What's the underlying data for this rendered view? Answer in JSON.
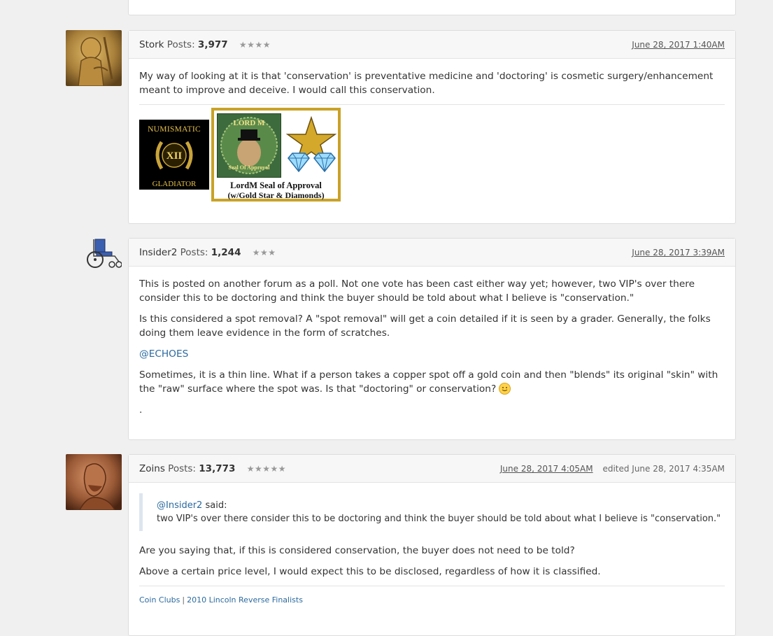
{
  "posts": [
    {
      "username": "Stork",
      "posts_label": "Posts:",
      "post_count": "3,977",
      "rank_stars": "★★★★",
      "date": "June 28, 2017 1:40AM",
      "paragraphs": [
        "My way of looking at it is that 'conservation' is preventative medicine and 'doctoring' is cosmetic surgery/enhancement meant to improve and deceive. I would call this conservation."
      ],
      "badges": {
        "gladiator": {
          "line1": "NUMISMATIC",
          "numeral": "XII",
          "line2": "GLADIATOR"
        },
        "seal": {
          "top_label": "LORD M",
          "seal_text": "Seal Of Approval",
          "caption1": "LordM Seal of Approval",
          "caption2": "(w/Gold Star & Diamonds)"
        }
      }
    },
    {
      "username": "Insider2",
      "posts_label": "Posts:",
      "post_count": "1,244",
      "rank_stars": "★★★",
      "date": "June 28, 2017 3:39AM",
      "paragraphs": [
        "This is posted on another forum as a poll. Not one vote has been cast either way yet; however, two VIP's over there consider this to be doctoring and think the buyer should be told about what I believe is \"conservation.\"",
        "Is this considered a spot removal? A \"spot removal\" will get a coin detailed if it is seen by a grader. Generally, the folks doing them leave evidence in the form of scratches.",
        "@ECHOES",
        "Sometimes, it is a thin line. What if a person takes a copper spot off a gold coin and then \"blends\" its original \"skin\" with the \"raw\" surface where the spot was. Is that \"doctoring\" or conservation?",
        "."
      ]
    },
    {
      "username": "Zoins",
      "posts_label": "Posts:",
      "post_count": "13,773",
      "rank_stars": "★★★★★",
      "date": "June 28, 2017 4:05AM",
      "edited": "edited June 28, 2017 4:35AM",
      "quote": {
        "author": "@Insider2",
        "said": "said:",
        "text": "two VIP's over there consider this to be doctoring and think the buyer should be told about what I believe is \"conservation.\""
      },
      "paragraphs": [
        "Are you saying that, if this is considered conservation, the buyer does not need to be told?",
        "Above a certain price level, I would expect this to be disclosed, regardless of how it is classified."
      ],
      "signature_links": [
        "Coin Clubs",
        "2010 Lincoln Reverse Finalists"
      ],
      "signature_sep": "|"
    }
  ],
  "colors": {
    "link": "#2b6a9e",
    "page_bg": "#f0f0f0",
    "card_border": "#dddddd",
    "header_bg": "#f7f7f7"
  },
  "icons": [
    "wheelchair-icon",
    "smiley-icon",
    "gold-star-icon",
    "diamond-icon"
  ]
}
